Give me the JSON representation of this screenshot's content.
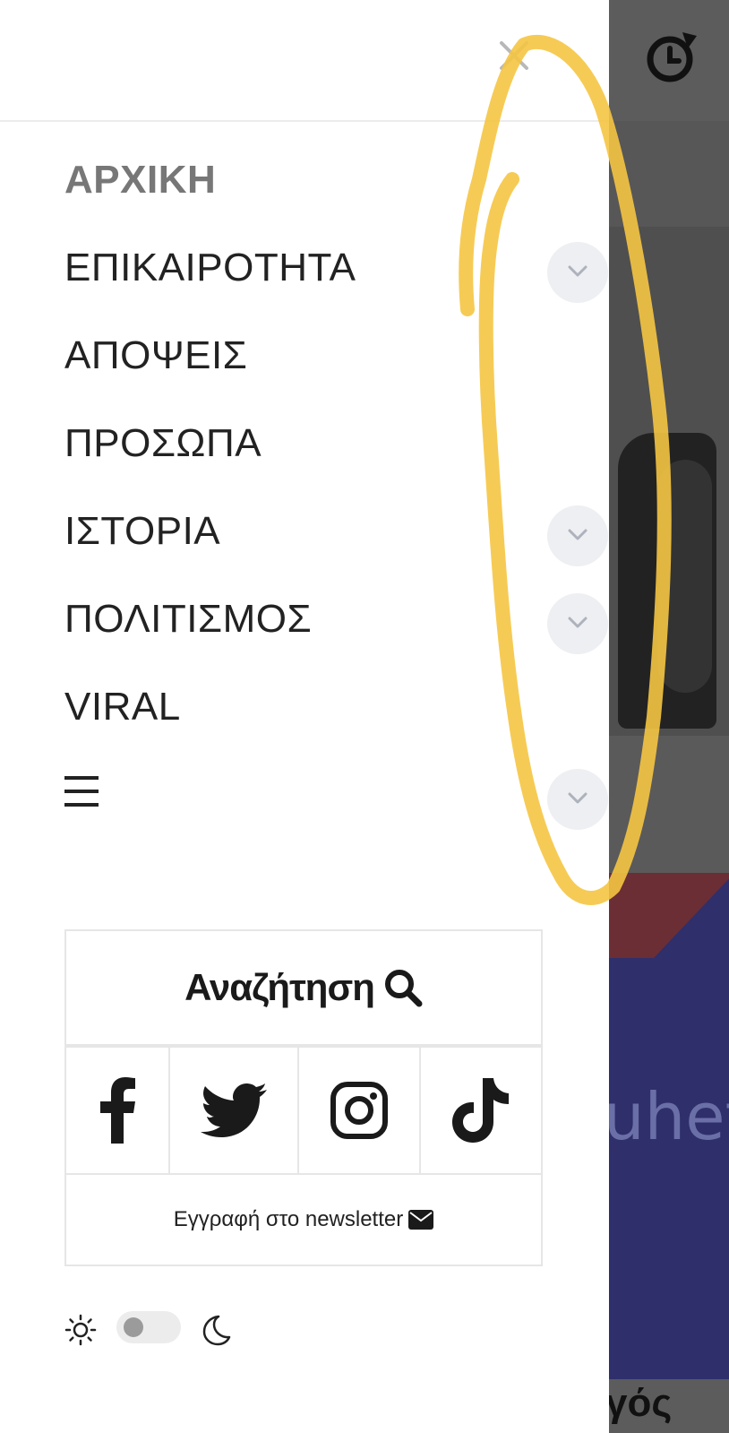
{
  "menu": {
    "items": [
      {
        "label": "ΑΡΧΙΚΗ",
        "active": true,
        "expandable": false
      },
      {
        "label": "ΕΠΙΚΑΙΡΟΤΗΤΑ",
        "active": false,
        "expandable": true
      },
      {
        "label": "ΑΠΟΨΕΙΣ",
        "active": false,
        "expandable": false
      },
      {
        "label": "ΠΡΟΣΩΠΑ",
        "active": false,
        "expandable": false
      },
      {
        "label": "ΙΣΤΟΡΙΑ",
        "active": false,
        "expandable": true
      },
      {
        "label": "ΠΟΛΙΤΙΣΜΟΣ",
        "active": false,
        "expandable": true
      },
      {
        "label": "VIRAL",
        "active": false,
        "expandable": false
      }
    ],
    "more_icon": "hamburger-icon"
  },
  "search": {
    "label": "Αναζήτηση",
    "icon": "search-icon"
  },
  "social": [
    "facebook-icon",
    "twitter-icon",
    "instagram-icon",
    "tiktok-icon"
  ],
  "newsletter": {
    "label": "Εγγραφή στο newsletter",
    "icon": "envelope-icon"
  },
  "theme": {
    "light_icon": "sun-icon",
    "dark_icon": "moon-icon",
    "dark_mode": false
  },
  "background_page": {
    "partial_text_1": "uhet",
    "partial_text_2": "γός"
  },
  "colors": {
    "annotation": "#f5c542",
    "overlay": "#5b5b5b",
    "accent_active": "#777777"
  }
}
